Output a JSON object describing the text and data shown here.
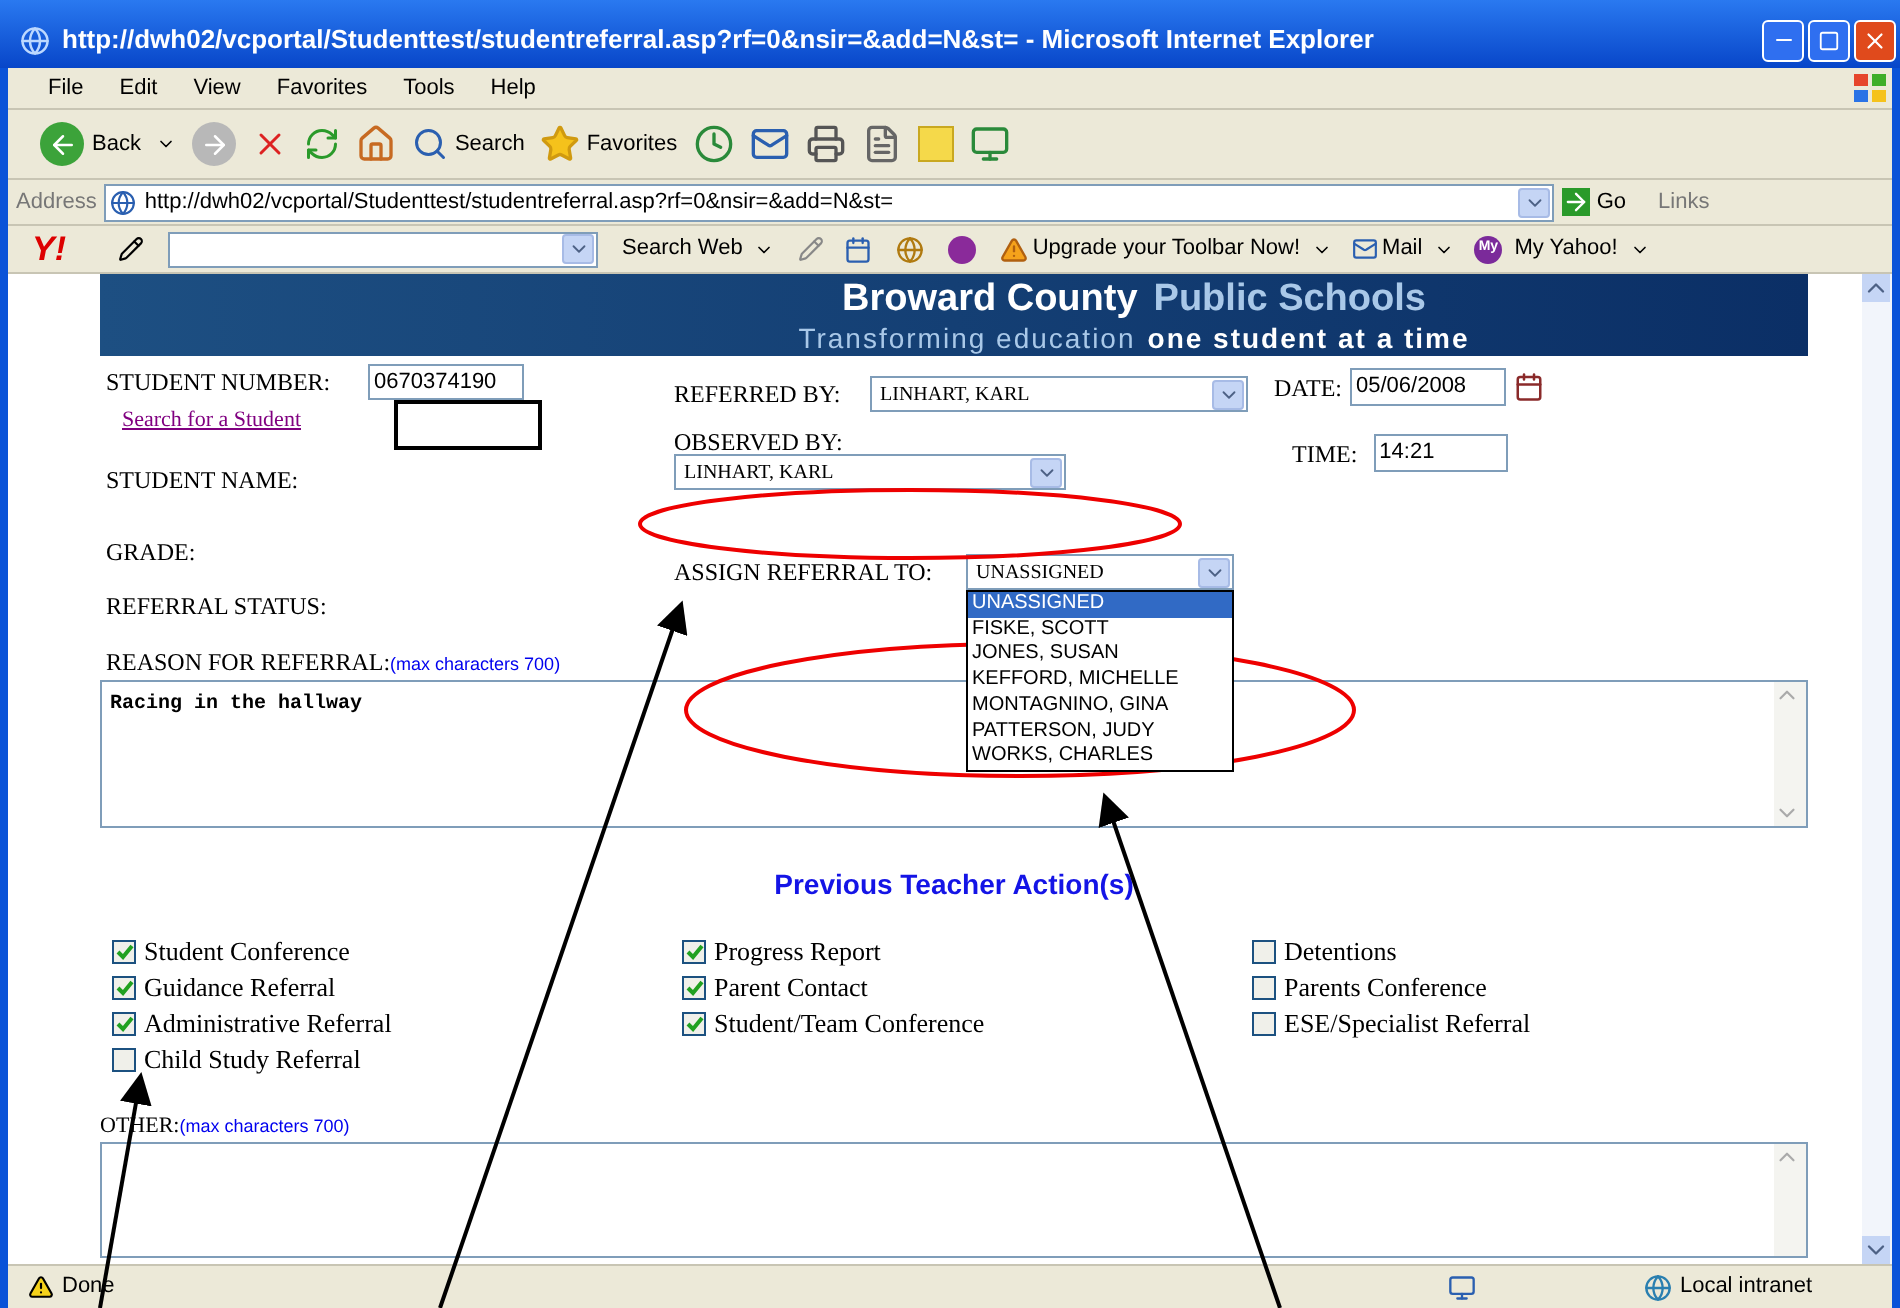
{
  "window": {
    "title": "http://dwh02/vcportal/Studenttest/studentreferral.asp?rf=0&nsir=&add=N&st= - Microsoft Internet Explorer"
  },
  "menu": [
    "File",
    "Edit",
    "View",
    "Favorites",
    "Tools",
    "Help"
  ],
  "toolbar": {
    "back": "Back",
    "search": "Search",
    "favorites": "Favorites"
  },
  "address": {
    "label": "Address",
    "url": "http://dwh02/vcportal/Studenttest/studentreferral.asp?rf=0&nsir=&add=N&st=",
    "go": "Go",
    "links": "Links"
  },
  "yahoo_bar": {
    "logo": "Y!",
    "search_button": "Search Web",
    "upgrade": "Upgrade your Toolbar Now!",
    "mail": "Mail",
    "my_badge": "My",
    "my_yahoo": "My Yahoo!"
  },
  "banner": {
    "title_a": "Broward County",
    "title_b": "Public Schools",
    "tagline_a": "Transforming education",
    "tagline_b": "one student at a time"
  },
  "form": {
    "student_number": {
      "label": "STUDENT NUMBER:",
      "value": "0670374190"
    },
    "search_link": "Search for a Student",
    "student_name": "STUDENT NAME:",
    "grade": "GRADE:",
    "referral_status": "REFERRAL STATUS:",
    "referred_by": {
      "label": "REFERRED BY:",
      "value": "LINHART, KARL"
    },
    "date": {
      "label": "DATE:",
      "value": "05/06/2008"
    },
    "observed_by": {
      "label": "OBSERVED BY:",
      "value": "LINHART, KARL"
    },
    "time": {
      "label": "TIME:",
      "value": "14:21"
    },
    "assign_to": {
      "label": "ASSIGN REFERRAL TO:",
      "value": "UNASSIGNED",
      "expanded": true,
      "options": [
        {
          "label": "UNASSIGNED",
          "selected": true
        },
        {
          "label": "FISKE, SCOTT",
          "selected": false
        },
        {
          "label": "JONES, SUSAN",
          "selected": false
        },
        {
          "label": "KEFFORD, MICHELLE",
          "selected": false
        },
        {
          "label": "MONTAGNINO, GINA",
          "selected": false
        },
        {
          "label": "PATTERSON, JUDY",
          "selected": false
        },
        {
          "label": "WORKS, CHARLES",
          "selected": false
        }
      ]
    },
    "reason": {
      "label": "REASON FOR REFERRAL:",
      "hint": "(max characters 700)",
      "value": "Racing in the hallway"
    }
  },
  "actions_heading": "Previous Teacher Action(s)",
  "action_columns": [
    [
      {
        "label": "Student Conference",
        "checked": true
      },
      {
        "label": "Guidance Referral",
        "checked": true
      },
      {
        "label": "Administrative Referral",
        "checked": true
      },
      {
        "label": "Child Study Referral",
        "checked": false
      }
    ],
    [
      {
        "label": "Progress Report",
        "checked": true
      },
      {
        "label": "Parent Contact",
        "checked": true
      },
      {
        "label": "Student/Team Conference",
        "checked": true
      }
    ],
    [
      {
        "label": "Detentions",
        "checked": false
      },
      {
        "label": "Parents Conference",
        "checked": false
      },
      {
        "label": "ESE/Specialist Referral",
        "checked": false
      }
    ]
  ],
  "other": {
    "label": "OTHER:",
    "hint": "(max characters 700)"
  },
  "status_bar": {
    "text": "Done",
    "zone": "Local intranet"
  }
}
